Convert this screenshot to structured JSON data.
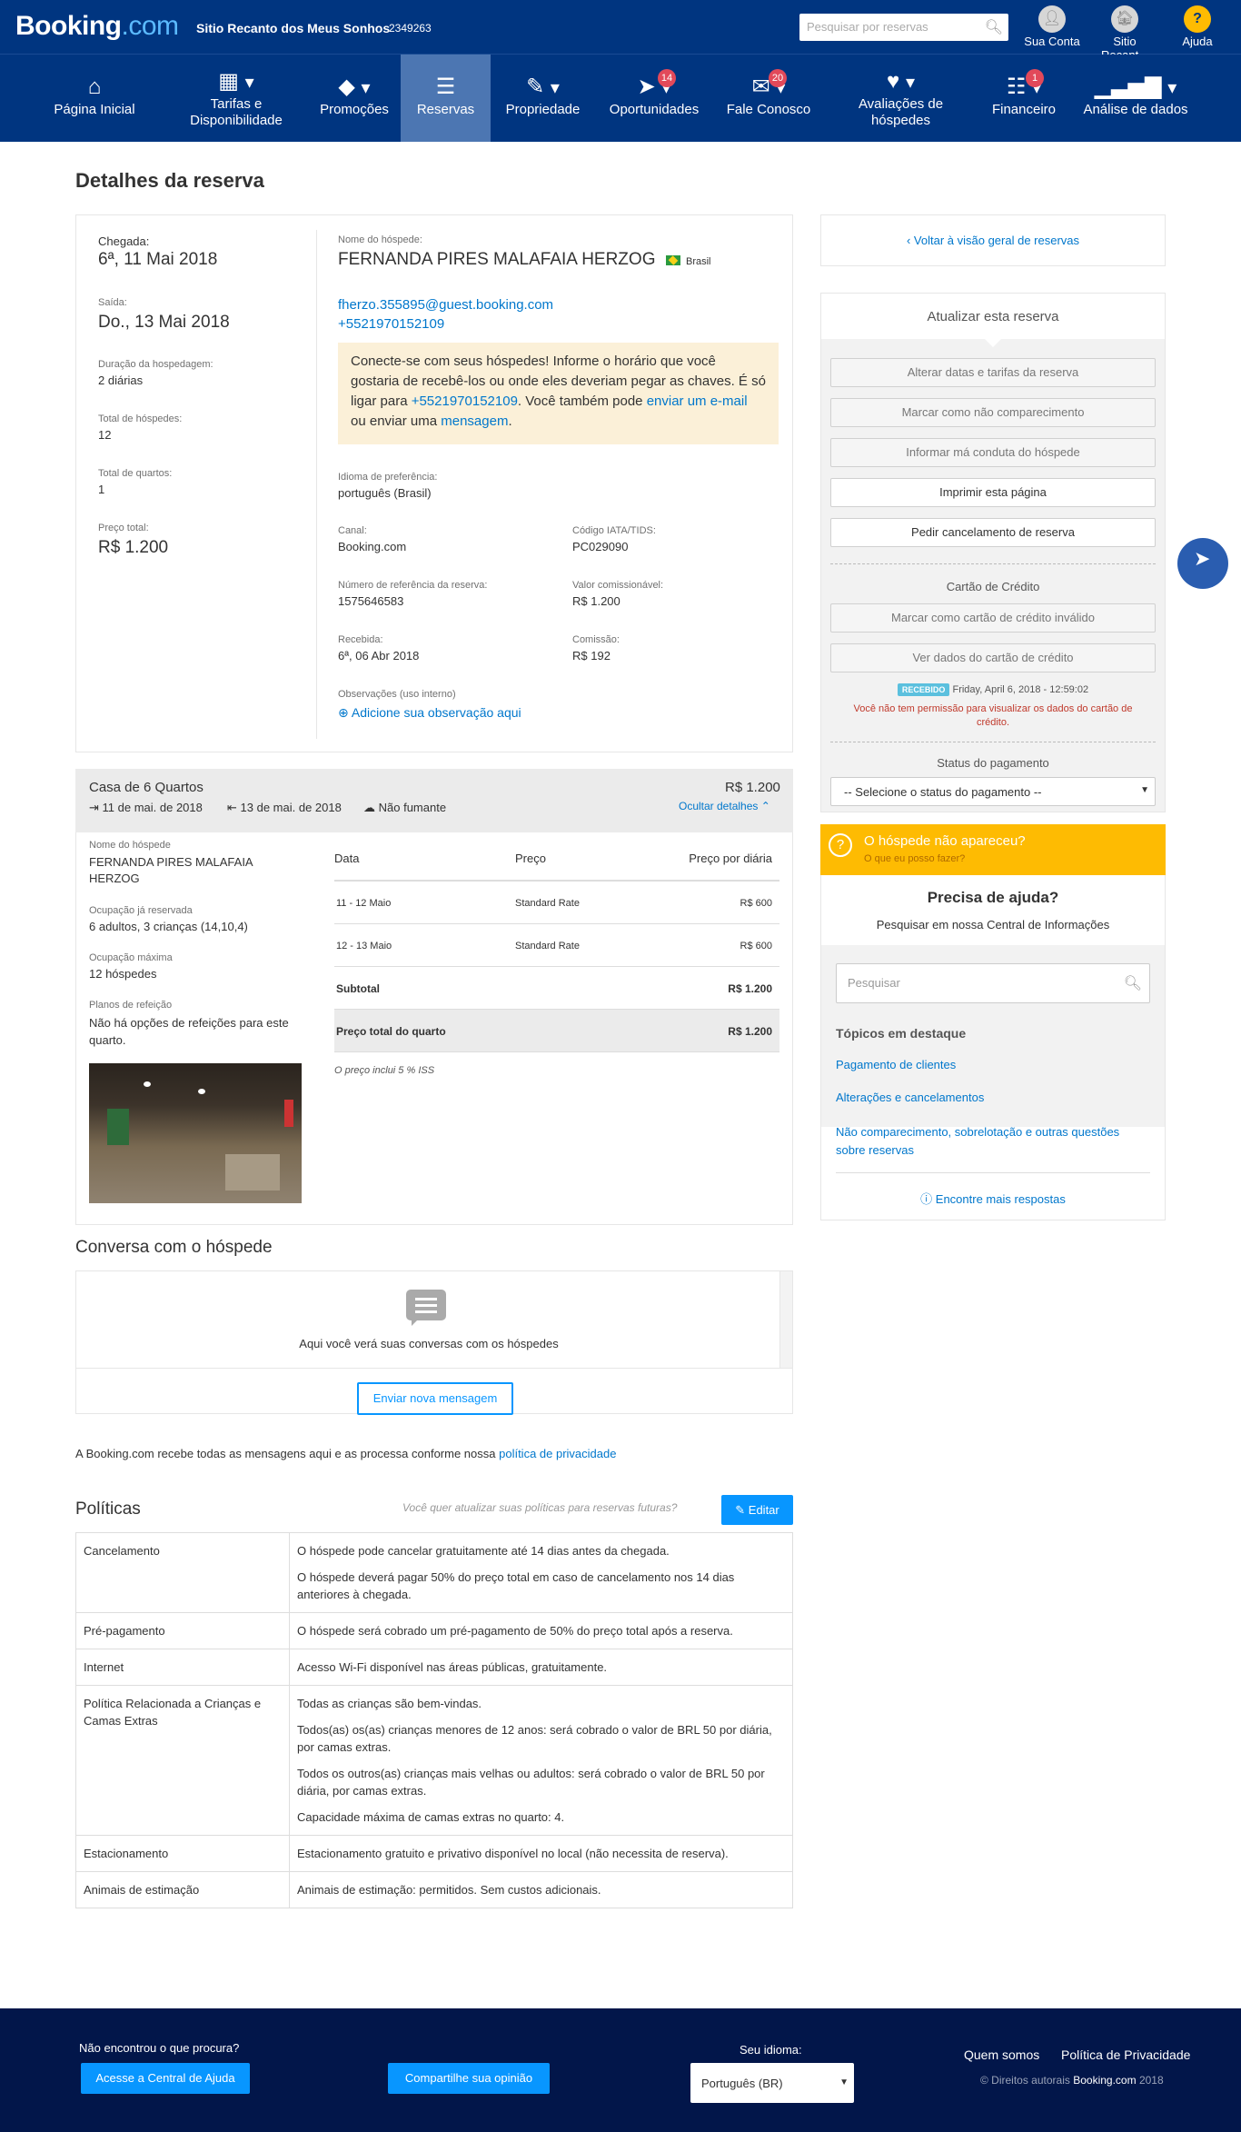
{
  "topbar": {
    "brand_main": "Booking",
    "brand_suffix": ".com",
    "property_name": "Sitio Recanto dos Meus Sonhos",
    "property_id": "2349263",
    "search_placeholder": "Pesquisar por reservas",
    "links": [
      {
        "label": "Sua Conta",
        "icon": "user-icon"
      },
      {
        "label": "Sitio Recant...",
        "icon": "property-icon"
      },
      {
        "label": "Ajuda",
        "icon": "help-icon"
      }
    ]
  },
  "nav": {
    "items": [
      {
        "label": "Página Inicial",
        "icon": "home-icon"
      },
      {
        "label": "Tarifas e Disponibilidade",
        "icon": "calendar-icon"
      },
      {
        "label": "Promoções",
        "icon": "tag-icon"
      },
      {
        "label": "Reservas",
        "icon": "list-icon"
      },
      {
        "label": "Propriedade",
        "icon": "pencil-icon"
      },
      {
        "label": "Oportunidades",
        "icon": "rocket-icon",
        "badge": "14"
      },
      {
        "label": "Fale Conosco",
        "icon": "envelope-icon",
        "badge": "20"
      },
      {
        "label": "Avaliações de hóspedes",
        "icon": "heart-icon"
      },
      {
        "label": "Financeiro",
        "icon": "document-icon",
        "badge": "1"
      },
      {
        "label": "Análise de dados",
        "icon": "bar-chart-icon"
      }
    ]
  },
  "page": {
    "title": "Detalhes da reserva"
  },
  "booking": {
    "checkin_label": "Chegada:",
    "checkin": "6ª, 11 Mai 2018",
    "checkout_label": "Saída:",
    "checkout": "Do., 13 Mai 2018",
    "duration_label": "Duração da hospedagem:",
    "duration": "2 diárias",
    "guests_label": "Total de hóspedes:",
    "guests": "12",
    "rooms_label": "Total de quartos:",
    "rooms": "1",
    "price_label": "Preço total:",
    "price": "R$ 1.200",
    "guest_name_label": "Nome do hóspede:",
    "guest_name": "FERNANDA PIRES MALAFAIA HERZOG",
    "country": "Brasil",
    "email": "fherzo.355895@guest.booking.com",
    "phone": "+5521970152109",
    "contact_text1": "Conecte-se com seus hóspedes! Informe o horário que você gostaria de recebê-los ou onde eles deveriam pegar as chaves. É só ligar para ",
    "contact_phone": "+5521970152109",
    "contact_text2": ". Você também pode ",
    "contact_email_link": "enviar um e-mail",
    "contact_text3": " ou enviar uma ",
    "contact_msg_link": "mensagem",
    "contact_text4": ".",
    "language_label": "Idioma de preferência:",
    "language": "português (Brasil)",
    "channel_label": "Canal:",
    "channel": "Booking.com",
    "iata_label": "Código IATA/TIDS:",
    "iata": "PC029090",
    "ref_label": "Número de referência da reserva:",
    "ref": "1575646583",
    "commissionable_label": "Valor comissionável:",
    "commissionable": "R$ 1.200",
    "received_label": "Recebida:",
    "received": "6ª, 06 Abr 2018",
    "commission_label": "Comissão:",
    "commission": "R$ 192",
    "notes_label": "Observações (uso interno)",
    "notes_add": "Adicione sua observação aqui"
  },
  "room": {
    "name": "Casa de 6 Quartos",
    "price": "R$ 1.200",
    "checkin": "11 de mai. de 2018",
    "checkout": "13 de mai. de 2018",
    "smoking": "Não fumante",
    "hide_details": "Ocultar detalhes",
    "guest_label": "Nome do hóspede",
    "guest": "FERNANDA PIRES MALAFAIA HERZOG",
    "occupancy_label": "Ocupação já reservada",
    "occupancy": "6 adultos, 3 crianças (14,10,4)",
    "max_label": "Ocupação máxima",
    "max": "12 hóspedes",
    "meals_label": "Planos de refeição",
    "meals": "Não há opções de refeições para este quarto.",
    "table_headers": [
      "Data",
      "Preço",
      "Preço por diária"
    ],
    "rows": [
      [
        "11 - 12 Maio",
        "Standard Rate",
        "R$ 600"
      ],
      [
        "12 - 13 Maio",
        "Standard Rate",
        "R$ 600"
      ]
    ],
    "subtotal_label": "Subtotal",
    "subtotal": "R$ 1.200",
    "total_label": "Preço total do quarto",
    "total": "R$ 1.200",
    "tax_note": "O preço inclui 5 % ISS"
  },
  "conversation": {
    "title": "Conversa com o hóspede",
    "empty": "Aqui você verá suas conversas com os hóspedes",
    "send": "Enviar nova mensagem",
    "privacy_text": "A Booking.com recebe todas as mensagens aqui e as processa conforme nossa ",
    "privacy_link": "política de privacidade"
  },
  "policies": {
    "title": "Políticas",
    "prompt": "Você quer atualizar suas políticas para reservas futuras?",
    "edit": "Editar",
    "rows": [
      {
        "name": "Cancelamento",
        "texts": [
          "O hóspede pode cancelar gratuitamente até 14 dias antes da chegada.",
          "O hóspede deverá pagar 50% do preço total em caso de cancelamento nos 14 dias anteriores à chegada."
        ]
      },
      {
        "name": "Pré-pagamento",
        "texts": [
          "O hóspede será cobrado um pré-pagamento de 50% do preço total após a reserva."
        ]
      },
      {
        "name": "Internet",
        "texts": [
          "Acesso Wi-Fi disponível nas áreas públicas, gratuitamente."
        ]
      },
      {
        "name": "Política Relacionada a Crianças e Camas Extras",
        "texts": [
          "Todas as crianças são bem-vindas.",
          "Todos(as) os(as) crianças menores de 12 anos: será cobrado o valor de BRL 50 por diária, por camas extras.",
          "Todos os outros(as) crianças mais velhas ou adultos: será cobrado o valor de BRL 50 por diária, por camas extras.",
          "Capacidade máxima de camas extras no quarto: 4."
        ]
      },
      {
        "name": "Estacionamento",
        "texts": [
          "Estacionamento gratuito e privativo disponível no local (não necessita de reserva)."
        ]
      },
      {
        "name": "Animais de estimação",
        "texts": [
          "Animais de estimação: permitidos. Sem custos adicionais."
        ]
      }
    ]
  },
  "sidebar": {
    "back": "Voltar à visão geral de reservas",
    "update_title": "Atualizar esta reserva",
    "actions": [
      "Alterar datas e tarifas da reserva",
      "Marcar como não comparecimento",
      "Informar má conduta do hóspede"
    ],
    "print": "Imprimir esta página",
    "cancel": "Pedir cancelamento de reserva",
    "cc_title": "Cartão de Crédito",
    "cc_invalid": "Marcar como cartão de crédito inválido",
    "cc_view": "Ver dados do cartão de crédito",
    "received_badge": "RECEBIDO",
    "received_date": "Friday, April 6, 2018 - 12:59:02",
    "cc_warning": "Você não tem permissão para visualizar os dados do cartão de crédito.",
    "payment_title": "Status do pagamento",
    "payment_select": "-- Selecione o status do pagamento --",
    "noshow_title": "O hóspede não apareceu?",
    "noshow_link": "O que eu posso fazer?",
    "help_title": "Precisa de ajuda?",
    "help_sub": "Pesquisar em nossa Central de Informações",
    "help_search": "Pesquisar",
    "topics_title": "Tópicos em destaque",
    "topics": [
      "Pagamento de clientes",
      "Alterações e cancelamentos",
      "Não comparecimento, sobrelotação e outras questões sobre reservas"
    ],
    "more": "Encontre mais respostas"
  },
  "footer": {
    "question": "Não encontrou o que procura?",
    "help_btn": "Acesse a Central de Ajuda",
    "share_btn": "Compartilhe sua opinião",
    "lang_label": "Seu idioma:",
    "lang": "Português (BR)",
    "about": "Quem somos",
    "privacy": "Política de Privacidade",
    "copyright_pre": "© Direitos autorais",
    "copyright_brand": "Booking.com",
    "copyright_year": "2018"
  },
  "colors": {
    "brand": "#003580",
    "accent": "#0896ff",
    "link": "#0077cc",
    "warning": "#febb02",
    "badge": "#e2495a"
  }
}
